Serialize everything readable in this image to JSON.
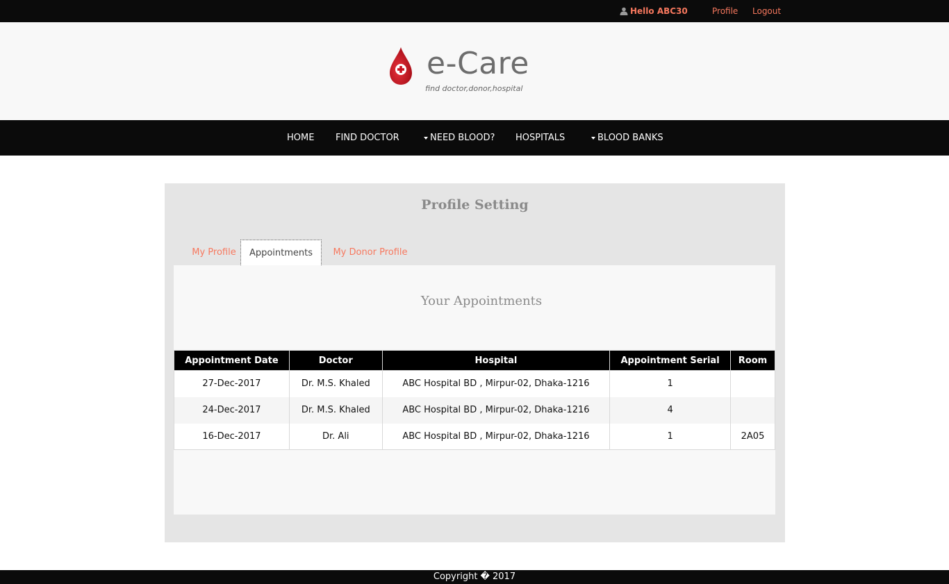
{
  "topbar": {
    "greeting": "Hello ABC30",
    "profile_link": "Profile",
    "logout_link": "Logout"
  },
  "brand": {
    "name": "e-Care",
    "tagline": "find doctor,donor,hospital"
  },
  "nav": {
    "home": "HOME",
    "find_doctor": "FIND DOCTOR",
    "need_blood": "NEED BLOOD?",
    "hospitals": "HOSPITALS",
    "blood_banks": "BLOOD BANKS"
  },
  "panel": {
    "title": "Profile Setting",
    "tabs": [
      "My Profile",
      "Appointments",
      "My Donor Profile"
    ],
    "active_tab": "Appointments"
  },
  "appointments": {
    "heading": "Your Appointments",
    "columns": [
      "Appointment Date",
      "Doctor",
      "Hospital",
      "Appointment Serial",
      "Room"
    ],
    "rows": [
      [
        "27-Dec-2017",
        "Dr. M.S. Khaled",
        "ABC Hospital BD , Mirpur-02, Dhaka-1216",
        "1",
        ""
      ],
      [
        "24-Dec-2017",
        "Dr. M.S. Khaled",
        "ABC Hospital BD , Mirpur-02, Dhaka-1216",
        "4",
        ""
      ],
      [
        "16-Dec-2017",
        "Dr. Ali",
        "ABC Hospital BD , Mirpur-02, Dhaka-1216",
        "1",
        "2A05"
      ]
    ]
  },
  "footer": {
    "text": "Copyright � 2017"
  },
  "colors": {
    "accent": "#f7785e",
    "bar": "#0b0b0b",
    "panel": "#e5e5e5",
    "logo_red": "#c8101e"
  },
  "icons": [
    "user-icon",
    "blood-drop-logo-icon",
    "caret-down-icon"
  ]
}
